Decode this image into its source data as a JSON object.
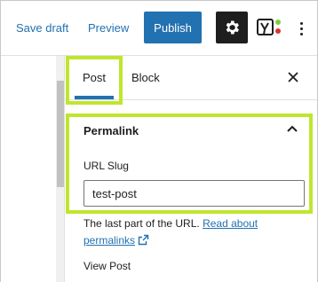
{
  "toolbar": {
    "save_draft": "Save draft",
    "preview": "Preview",
    "publish": "Publish",
    "settings_icon": "gear-icon",
    "yoast_icon": "yoast-seo-icon",
    "more_icon": "vertical-ellipsis-icon"
  },
  "sidebar": {
    "tabs": [
      {
        "label": "Post",
        "active": true
      },
      {
        "label": "Block",
        "active": false
      }
    ],
    "close_icon": "close-icon",
    "permalink": {
      "title": "Permalink",
      "chevron_icon": "chevron-up-icon",
      "slug_label": "URL Slug",
      "slug_value": "test-post",
      "help_text": "The last part of the URL.",
      "help_link": "Read about permalinks",
      "external_icon": "external-link-icon",
      "view_post": "View Post"
    }
  },
  "colors": {
    "accent": "#2271b1",
    "highlight": "#bfe62e",
    "dark": "#1e1e1e"
  }
}
